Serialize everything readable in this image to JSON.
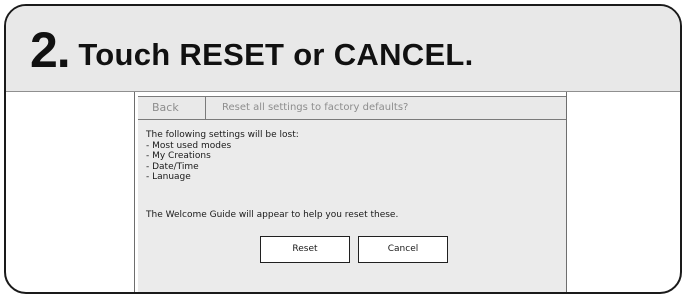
{
  "heading": {
    "number": "2.",
    "text": "Touch RESET or CANCEL."
  },
  "screen": {
    "back_label": "Back",
    "title": "Reset all settings to factory defaults?",
    "intro": "The following settings will be lost:",
    "items": [
      "- Most used modes",
      "- My Creations",
      "- Date/Time",
      "- Lanuage"
    ],
    "welcome_note": "The Welcome Guide will appear to help you reset these.",
    "reset_label": "Reset",
    "cancel_label": "Cancel"
  },
  "colors": {
    "heading_bg": "#e8e8e8",
    "panel_bg": "#ebebeb",
    "border": "#1a1a1a",
    "muted_text": "#8d8d8d"
  }
}
